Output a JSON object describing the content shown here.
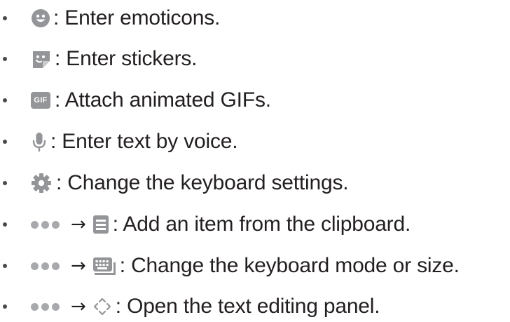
{
  "items": [
    {
      "icon": "emoticon-icon",
      "text": ": Enter emoticons."
    },
    {
      "icon": "sticker-icon",
      "text": ": Enter stickers."
    },
    {
      "icon": "gif-icon",
      "gif_label": "GIF",
      "text": ": Attach animated GIFs."
    },
    {
      "icon": "microphone-icon",
      "text": ": Enter text by voice."
    },
    {
      "icon": "gear-icon",
      "text": ": Change the keyboard settings."
    },
    {
      "icon": "clipboard-icon",
      "prefix": [
        "more-dots-icon",
        "arrow"
      ],
      "arrow": "→",
      "text": ": Add an item from the clipboard."
    },
    {
      "icon": "keyboard-icon",
      "prefix": [
        "more-dots-icon",
        "arrow"
      ],
      "arrow": "→",
      "text": ": Change the keyboard mode or size."
    },
    {
      "icon": "text-editing-icon",
      "prefix": [
        "more-dots-icon",
        "arrow"
      ],
      "arrow": "→",
      "text": ": Open the text editing panel."
    }
  ],
  "colors": {
    "text": "#231f20",
    "icon": "#939598",
    "dots": "#a7a9ac"
  }
}
